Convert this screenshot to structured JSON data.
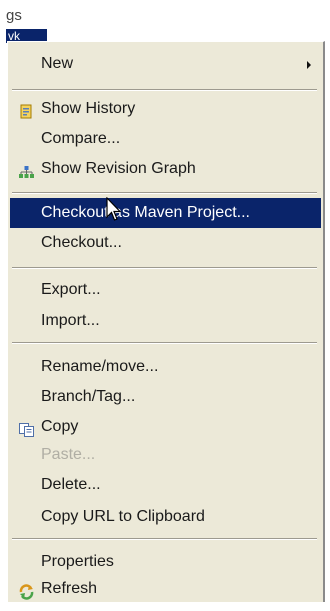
{
  "tree": {
    "partial_label": "gs",
    "selected_label": "vk"
  },
  "menu": {
    "items": [
      {
        "label": "New",
        "icon": "",
        "submenu": true
      },
      {
        "label": "Show History",
        "icon": "history-icon"
      },
      {
        "label": "Compare...",
        "icon": ""
      },
      {
        "label": "Show Revision Graph",
        "icon": "revision-graph-icon"
      },
      {
        "label": "Checkout as Maven Project...",
        "icon": "",
        "highlighted": true
      },
      {
        "label": "Checkout...",
        "icon": ""
      },
      {
        "label": "Export...",
        "icon": ""
      },
      {
        "label": "Import...",
        "icon": ""
      },
      {
        "label": "Rename/move...",
        "icon": ""
      },
      {
        "label": "Branch/Tag...",
        "icon": ""
      },
      {
        "label": "Copy",
        "icon": "copy-icon"
      },
      {
        "label": "Paste...",
        "icon": "",
        "disabled": true
      },
      {
        "label": "Delete...",
        "icon": ""
      },
      {
        "label": "Copy URL to Clipboard",
        "icon": ""
      },
      {
        "label": "Properties",
        "icon": ""
      },
      {
        "label": "Refresh",
        "icon": "refresh-icon"
      }
    ]
  },
  "colors": {
    "menu_bg": "#ece9d8",
    "highlight": "#0a246a",
    "disabled_text": "#b0aea4"
  }
}
